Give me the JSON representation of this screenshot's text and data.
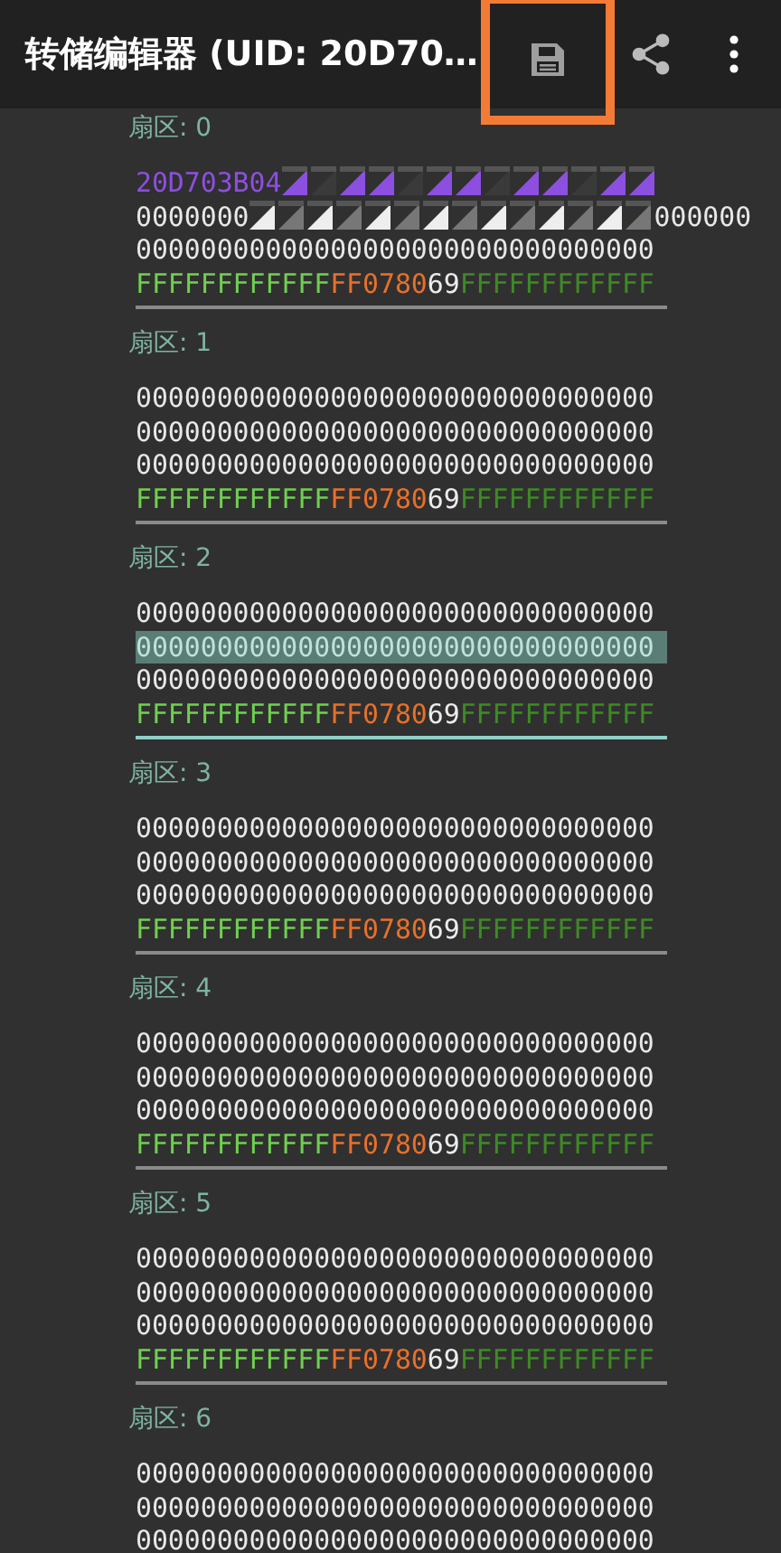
{
  "toolbar": {
    "title": "转储编辑器 (UID: 20D70…",
    "actions": [
      {
        "kind": "save",
        "highlighted": true
      },
      {
        "kind": "share",
        "highlighted": false
      },
      {
        "kind": "more",
        "highlighted": false
      }
    ]
  },
  "sectors": [
    {
      "label": "扇区: 0",
      "selected": false,
      "rows": [
        {
          "kind": "uid_masked",
          "text": "20D703B04",
          "tail": "",
          "selected": false
        },
        {
          "kind": "data_masked",
          "text": "0000000",
          "tail": "000000",
          "selected": false
        },
        {
          "kind": "data",
          "text": "00000000000000000000000000000000",
          "selected": false
        },
        {
          "kind": "trailer",
          "key_a": "FFFFFFFFFFFF",
          "access": "FF0780",
          "user_byte": "69",
          "key_b": "FFFFFFFFFFFF"
        }
      ]
    },
    {
      "label": "扇区: 1",
      "selected": false,
      "rows": [
        {
          "kind": "data",
          "text": "00000000000000000000000000000000",
          "selected": false
        },
        {
          "kind": "data",
          "text": "00000000000000000000000000000000",
          "selected": false
        },
        {
          "kind": "data",
          "text": "00000000000000000000000000000000",
          "selected": false
        },
        {
          "kind": "trailer",
          "key_a": "FFFFFFFFFFFF",
          "access": "FF0780",
          "user_byte": "69",
          "key_b": "FFFFFFFFFFFF"
        }
      ]
    },
    {
      "label": "扇区: 2",
      "selected": true,
      "rows": [
        {
          "kind": "data",
          "text": "00000000000000000000000000000000",
          "selected": false
        },
        {
          "kind": "data",
          "text": "00000000000000000000000000000000",
          "selected": true
        },
        {
          "kind": "data",
          "text": "00000000000000000000000000000000",
          "selected": false
        },
        {
          "kind": "trailer",
          "key_a": "FFFFFFFFFFFF",
          "access": "FF0780",
          "user_byte": "69",
          "key_b": "FFFFFFFFFFFF"
        }
      ]
    },
    {
      "label": "扇区: 3",
      "selected": false,
      "rows": [
        {
          "kind": "data",
          "text": "00000000000000000000000000000000",
          "selected": false
        },
        {
          "kind": "data",
          "text": "00000000000000000000000000000000",
          "selected": false
        },
        {
          "kind": "data",
          "text": "00000000000000000000000000000000",
          "selected": false
        },
        {
          "kind": "trailer",
          "key_a": "FFFFFFFFFFFF",
          "access": "FF0780",
          "user_byte": "69",
          "key_b": "FFFFFFFFFFFF"
        }
      ]
    },
    {
      "label": "扇区: 4",
      "selected": false,
      "rows": [
        {
          "kind": "data",
          "text": "00000000000000000000000000000000",
          "selected": false
        },
        {
          "kind": "data",
          "text": "00000000000000000000000000000000",
          "selected": false
        },
        {
          "kind": "data",
          "text": "00000000000000000000000000000000",
          "selected": false
        },
        {
          "kind": "trailer",
          "key_a": "FFFFFFFFFFFF",
          "access": "FF0780",
          "user_byte": "69",
          "key_b": "FFFFFFFFFFFF"
        }
      ]
    },
    {
      "label": "扇区: 5",
      "selected": false,
      "rows": [
        {
          "kind": "data",
          "text": "00000000000000000000000000000000",
          "selected": false
        },
        {
          "kind": "data",
          "text": "00000000000000000000000000000000",
          "selected": false
        },
        {
          "kind": "data",
          "text": "00000000000000000000000000000000",
          "selected": false
        },
        {
          "kind": "trailer",
          "key_a": "FFFFFFFFFFFF",
          "access": "FF0780",
          "user_byte": "69",
          "key_b": "FFFFFFFFFFFF"
        }
      ]
    },
    {
      "label": "扇区: 6",
      "rows": [
        {
          "kind": "data",
          "text": "00000000000000000000000000000000",
          "selected": false
        },
        {
          "kind": "data",
          "text": "00000000000000000000000000000000",
          "selected": false
        },
        {
          "kind": "data",
          "text": "00000000000000000000000000000000",
          "selected": false
        }
      ]
    }
  ]
}
